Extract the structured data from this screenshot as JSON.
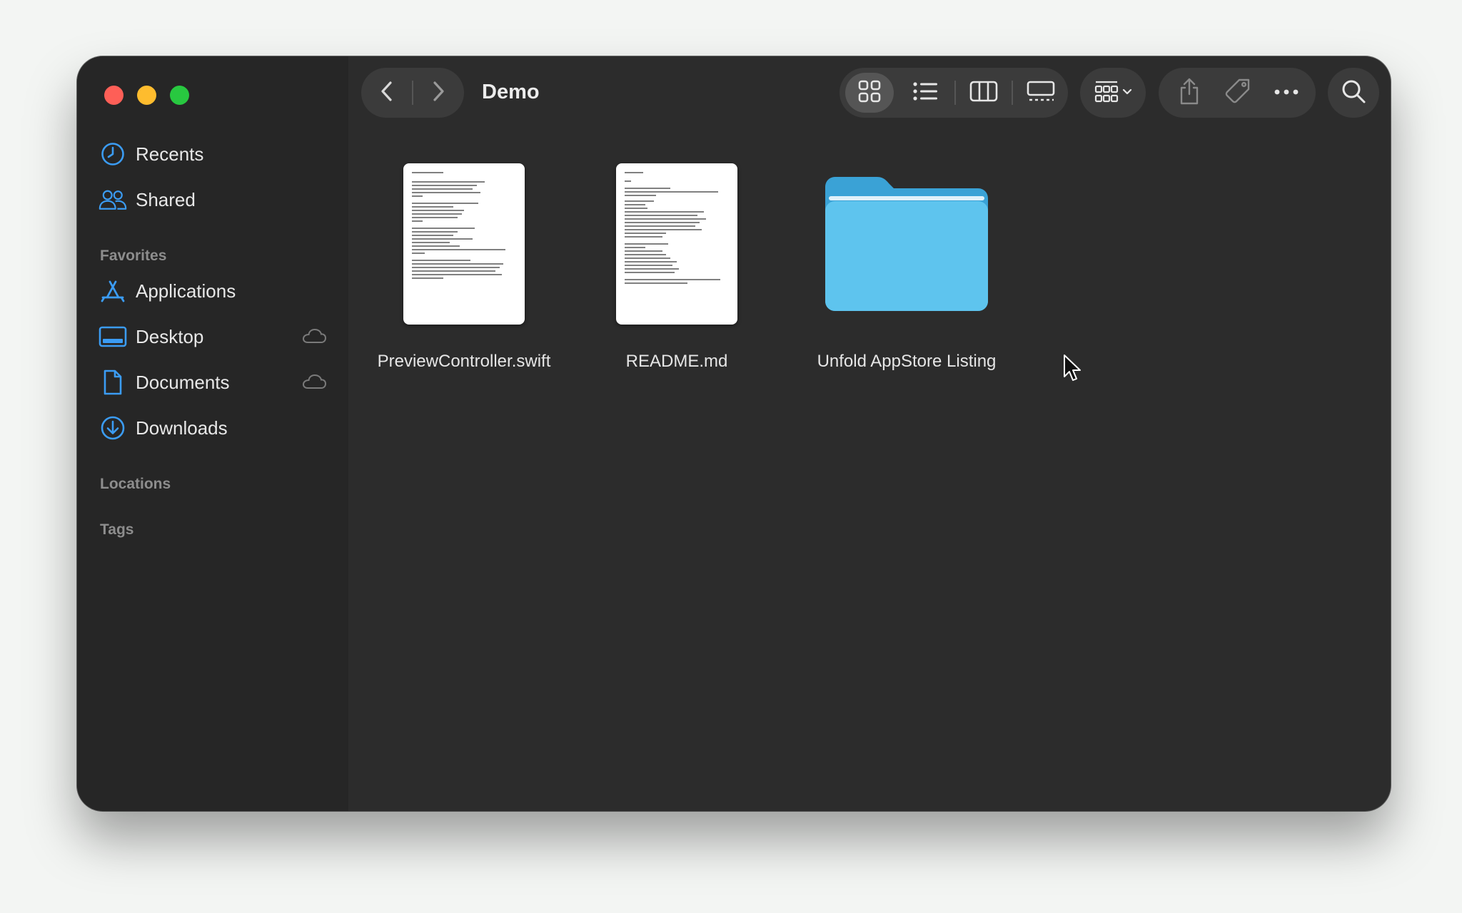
{
  "window": {
    "title": "Demo"
  },
  "sidebar": {
    "recents_label": "Recents",
    "shared_label": "Shared",
    "favorites_header": "Favorites",
    "favorites": [
      {
        "label": "Applications",
        "icon": "app-store-icon",
        "cloud": false
      },
      {
        "label": "Desktop",
        "icon": "desktop-icon",
        "cloud": true
      },
      {
        "label": "Documents",
        "icon": "document-icon",
        "cloud": true
      },
      {
        "label": "Downloads",
        "icon": "download-icon",
        "cloud": false
      }
    ],
    "locations_header": "Locations",
    "tags_header": "Tags"
  },
  "toolbar": {
    "view_modes": [
      "icon-view-icon",
      "list-view-icon",
      "column-view-icon",
      "gallery-view-icon"
    ],
    "selected_view": "icon-view-icon",
    "group_icon": "group-by-icon",
    "share_icon": "share-icon",
    "tag_icon": "tag-icon",
    "more_icon": "more-icon",
    "search_icon": "search-icon"
  },
  "files": [
    {
      "name": "PreviewController.swift",
      "kind": "document"
    },
    {
      "name": "README.md",
      "kind": "document"
    },
    {
      "name": "Unfold AppStore Listing",
      "kind": "folder"
    }
  ],
  "colors": {
    "accent": "#3b9cf4",
    "folder": "#4fb8ea",
    "window_bg": "#2c2c2c",
    "sidebar_bg": "#262626"
  }
}
